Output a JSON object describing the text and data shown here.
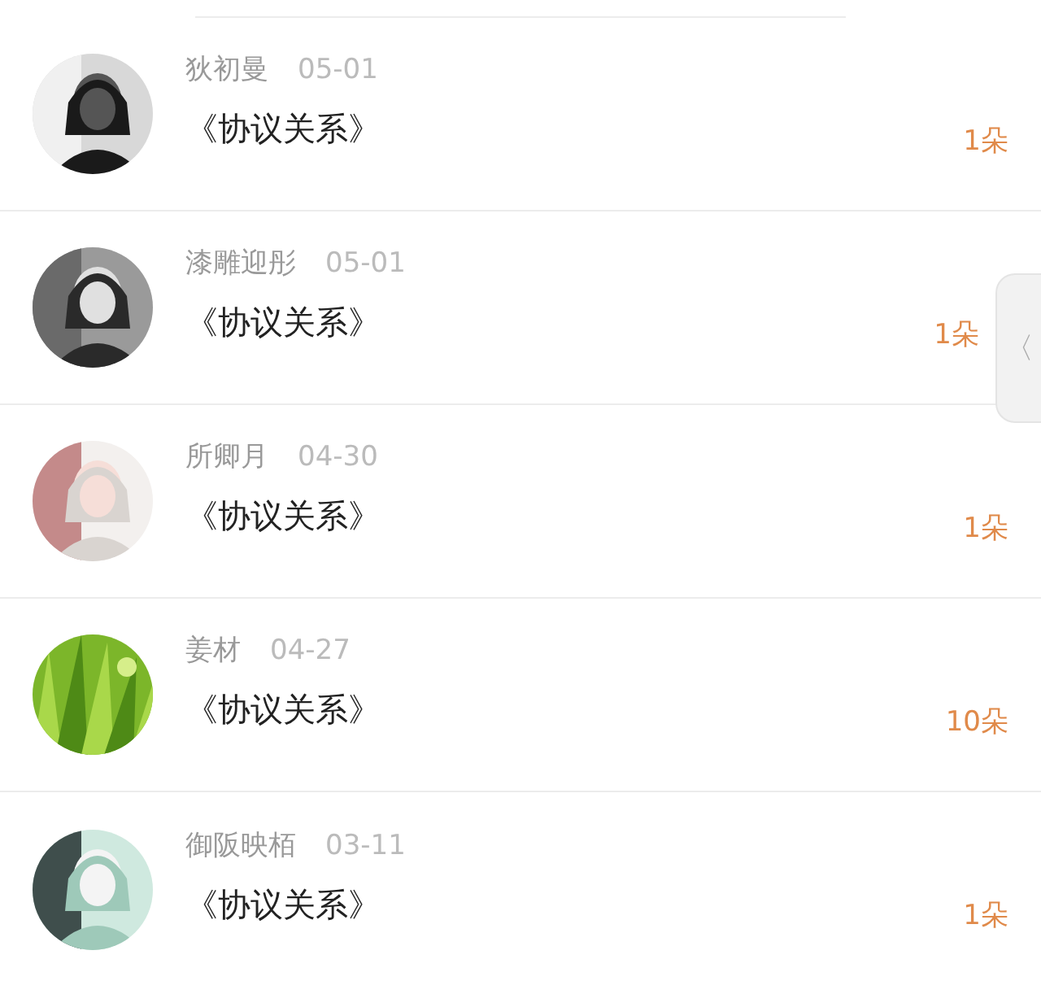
{
  "side_tab": {
    "icon": "〈"
  },
  "items": [
    {
      "name": "狄初曼",
      "date": "05-01",
      "title": "《协议关系》",
      "count": "1朵"
    },
    {
      "name": "漆雕迎彤",
      "date": "05-01",
      "title": "《协议关系》",
      "count": "1朵"
    },
    {
      "name": "所卿月",
      "date": "04-30",
      "title": "《协议关系》",
      "count": "1朵"
    },
    {
      "name": "姜材",
      "date": "04-27",
      "title": "《协议关系》",
      "count": "10朵"
    },
    {
      "name": "御阪映栢",
      "date": "03-11",
      "title": "《协议关系》",
      "count": "1朵"
    }
  ]
}
